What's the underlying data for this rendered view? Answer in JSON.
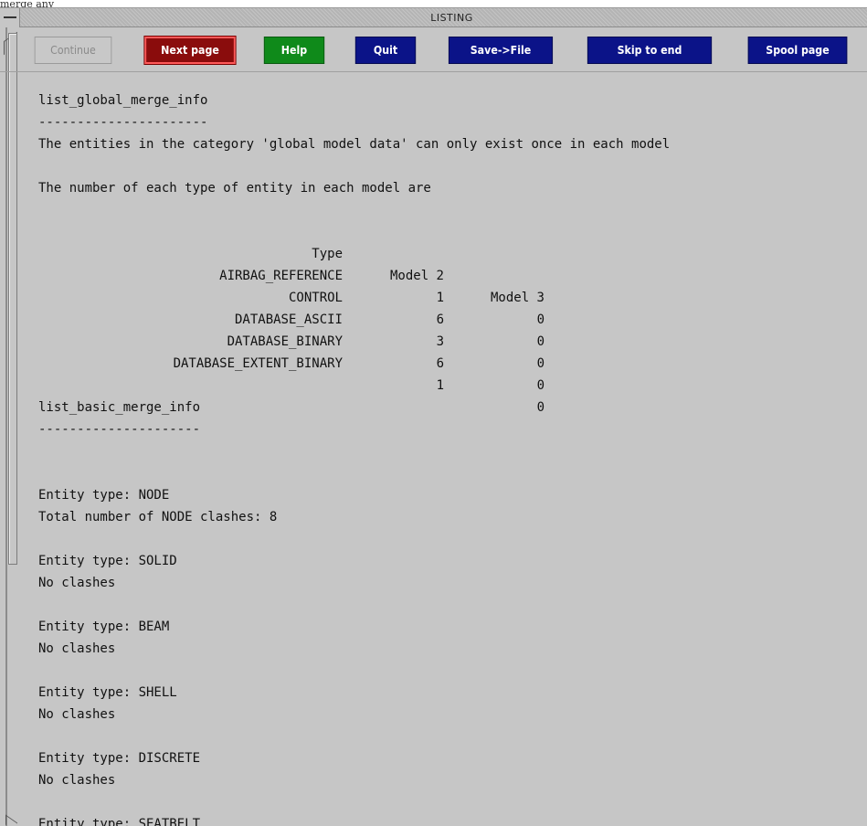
{
  "caption": "merge any",
  "window": {
    "title": "LISTING"
  },
  "toolbar": {
    "continue": "Continue",
    "next_page": "Next page",
    "help": "Help",
    "quit": "Quit",
    "save_file": "Save->File",
    "skip_to_end": "Skip to end",
    "spool_page": "Spool page"
  },
  "listing": {
    "global_heading": "list_global_merge_info",
    "global_rule": "----------------------",
    "global_line1": "The entities in the category 'global model data' can only exist once in each model",
    "global_line2": "The number of each type of entity in each model are",
    "table_header": {
      "type": "Type",
      "model2": "Model 2",
      "model3": "Model 3"
    },
    "table_rows": [
      {
        "type": "AIRBAG_REFERENCE",
        "model2": "1",
        "model3": "0"
      },
      {
        "type": "CONTROL",
        "model2": "6",
        "model3": "0"
      },
      {
        "type": "DATABASE_ASCII",
        "model2": "3",
        "model3": "0"
      },
      {
        "type": "DATABASE_BINARY",
        "model2": "6",
        "model3": "0"
      },
      {
        "type": "DATABASE_EXTENT_BINARY",
        "model2": "1",
        "model3": "0"
      }
    ],
    "basic_heading": "list_basic_merge_info",
    "basic_rule": "---------------------",
    "entities": [
      {
        "type": "Entity type: NODE",
        "status": "Total number of NODE clashes: 8"
      },
      {
        "type": "Entity type: SOLID",
        "status": "No clashes"
      },
      {
        "type": "Entity type: BEAM",
        "status": "No clashes"
      },
      {
        "type": "Entity type: SHELL",
        "status": "No clashes"
      },
      {
        "type": "Entity type: DISCRETE",
        "status": "No clashes"
      },
      {
        "type": "Entity type: SEATBELT",
        "status": ""
      }
    ]
  }
}
